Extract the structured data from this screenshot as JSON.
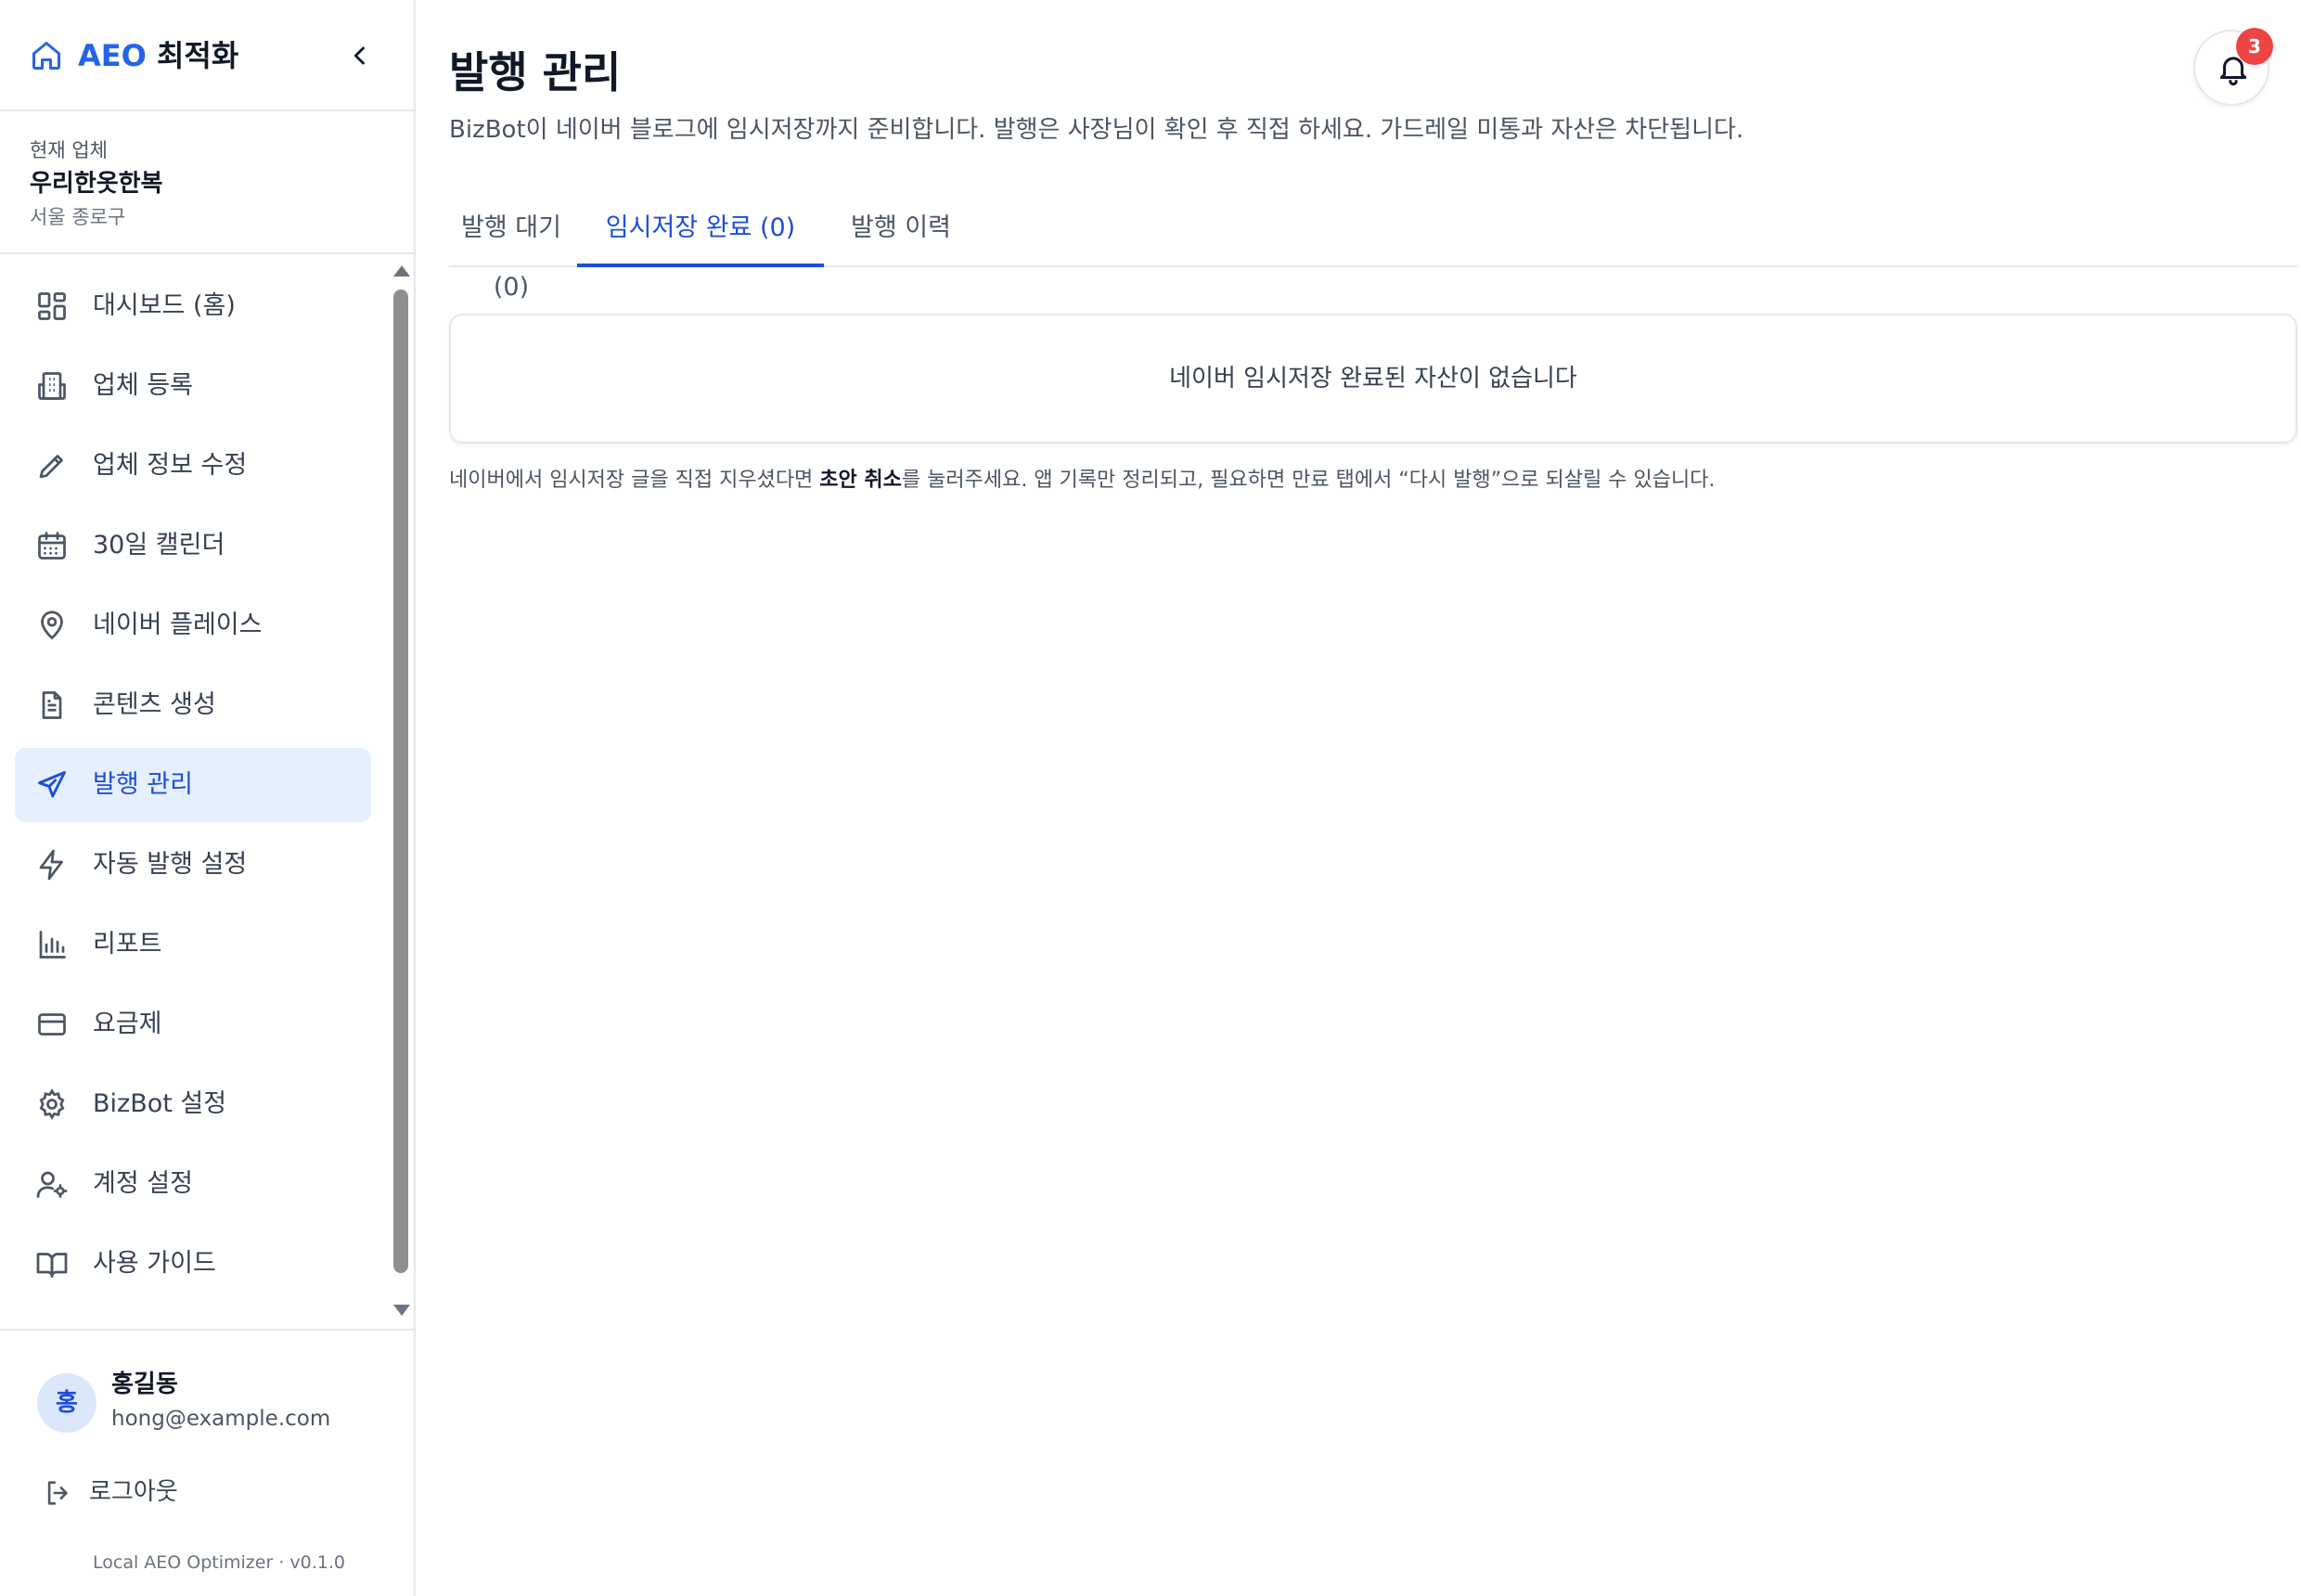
{
  "brand": {
    "name_accent": "AEO",
    "name_rest": "최적화"
  },
  "business": {
    "caption": "현재 업체",
    "name": "우리한옷한복",
    "location": "서울 종로구"
  },
  "nav": {
    "items": [
      {
        "label": "대시보드 (홈)",
        "icon": "dashboard-icon"
      },
      {
        "label": "업체 등록",
        "icon": "building-icon"
      },
      {
        "label": "업체 정보 수정",
        "icon": "pencil-icon"
      },
      {
        "label": "30일 캘린더",
        "icon": "calendar-icon"
      },
      {
        "label": "네이버 플레이스",
        "icon": "map-pin-icon"
      },
      {
        "label": "콘텐츠 생성",
        "icon": "document-icon"
      },
      {
        "label": "발행 관리",
        "icon": "send-icon",
        "active": true
      },
      {
        "label": "자동 발행 설정",
        "icon": "lightning-icon"
      },
      {
        "label": "리포트",
        "icon": "bar-chart-icon"
      },
      {
        "label": "요금제",
        "icon": "credit-card-icon"
      },
      {
        "label": "BizBot 설정",
        "icon": "gear-icon"
      },
      {
        "label": "계정 설정",
        "icon": "user-gear-icon"
      },
      {
        "label": "사용 가이드",
        "icon": "book-icon"
      }
    ]
  },
  "user": {
    "initial": "홍",
    "name": "홍길동",
    "email": "hong@example.com"
  },
  "logout": {
    "label": "로그아웃"
  },
  "version": "Local AEO Optimizer · v0.1.0",
  "header": {
    "title": "발행 관리",
    "subtitle": "BizBot이 네이버 블로그에 임시저장까지 준비합니다. 발행은 사장님이 확인 후 직접 하세요. 가드레일 미통과 자산은 차단됩니다."
  },
  "notifications": {
    "count": "3"
  },
  "tabs": [
    {
      "label": "발행 대기 (0)"
    },
    {
      "label": "임시저장 완료 (0)",
      "active": true
    },
    {
      "label": "발행 이력"
    }
  ],
  "empty": {
    "message": "네이버 임시저장 완료된 자산이 없습니다"
  },
  "hint": {
    "before": "네이버에서 임시저장 글을 직접 지우셨다면 ",
    "bold": "초안 취소",
    "after": "를 눌러주세요. 앱 기록만 정리되고, 필요하면 만료 탭에서 “다시 발행”으로 되살릴 수 있습니다."
  },
  "colors": {
    "accent": "#1d4ed8",
    "active_bg": "#e6effe",
    "badge": "#ef4444"
  }
}
